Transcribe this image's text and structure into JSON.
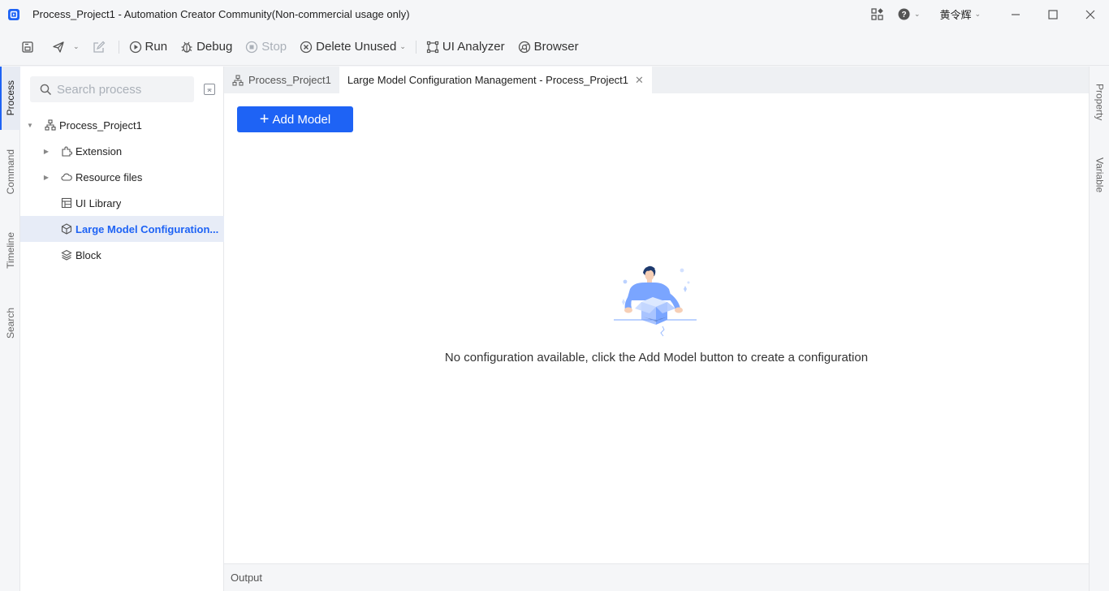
{
  "window": {
    "title": "Process_Project1 - Automation Creator Community(Non-commercial usage only)",
    "user_name": "黄令辉"
  },
  "toolbar": {
    "run_label": "Run",
    "debug_label": "Debug",
    "stop_label": "Stop",
    "delete_unused_label": "Delete Unused",
    "ui_analyzer_label": "UI Analyzer",
    "browser_label": "Browser"
  },
  "left_tabs": {
    "process": "Process",
    "command": "Command",
    "timeline": "Timeline",
    "search": "Search"
  },
  "sidebar": {
    "search_placeholder": "Search process",
    "tree": {
      "root": "Process_Project1",
      "items": [
        {
          "label": "Extension",
          "icon": "extension-icon"
        },
        {
          "label": "Resource files",
          "icon": "cloud-icon"
        },
        {
          "label": "UI Library",
          "icon": "table-icon"
        },
        {
          "label": "Large Model Configuration...",
          "icon": "cube-icon"
        },
        {
          "label": "Block",
          "icon": "layers-icon"
        }
      ]
    }
  },
  "editor_tabs": [
    {
      "label": "Process_Project1"
    },
    {
      "label": "Large Model Configuration Management - Process_Project1"
    }
  ],
  "main": {
    "add_model_label": "Add Model",
    "empty_message": "No configuration available, click the Add Model button to create a configuration"
  },
  "output": {
    "label": "Output"
  },
  "right_tabs": {
    "property": "Property",
    "variable": "Variable"
  },
  "colors": {
    "accent": "#1e63f5",
    "selected_bg": "#e7ecf7",
    "chrome_bg": "#f5f6f8"
  }
}
